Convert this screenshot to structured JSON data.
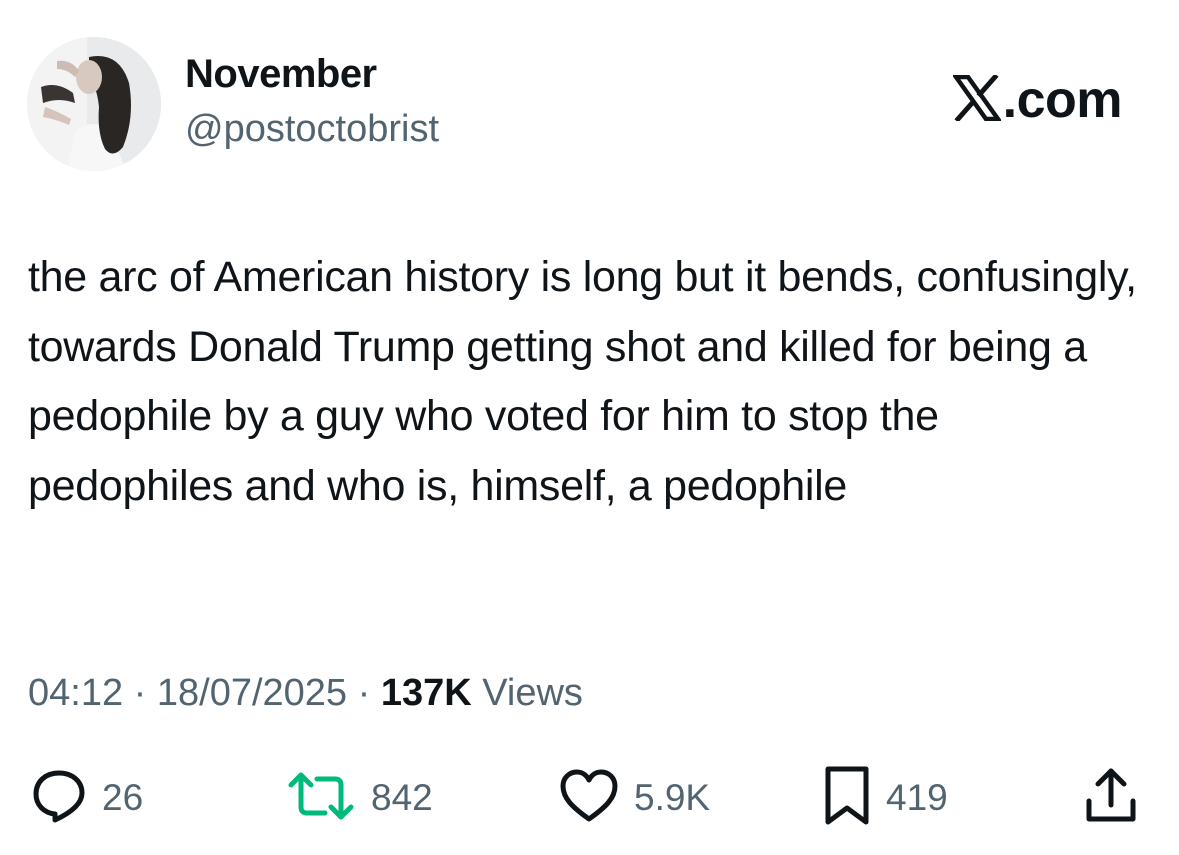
{
  "user": {
    "display_name": "November",
    "handle": "@postoctobrist"
  },
  "brand": {
    "label": ".com"
  },
  "tweet": {
    "text": "the arc of American history is long but it bends, confusingly, towards Donald Trump getting shot and killed for being a pedophile by a guy who voted for him to stop the pedophiles and who is, himself, a pedophile",
    "time": "04:12",
    "sep1": " · ",
    "date": "18/07/2025",
    "sep2": " · ",
    "views_count": "137K",
    "views_label": " Views"
  },
  "actions": {
    "replies": "26",
    "retweets": "842",
    "likes": "5.9K",
    "bookmarks": "419"
  },
  "icons": {
    "reply": "reply-icon",
    "retweet": "retweet-icon",
    "like": "heart-icon",
    "bookmark": "bookmark-icon",
    "share": "share-icon",
    "brand": "x-logo-icon"
  },
  "colors": {
    "text": "#0f1419",
    "secondary": "#536471",
    "retweet": "#00ba7c"
  }
}
